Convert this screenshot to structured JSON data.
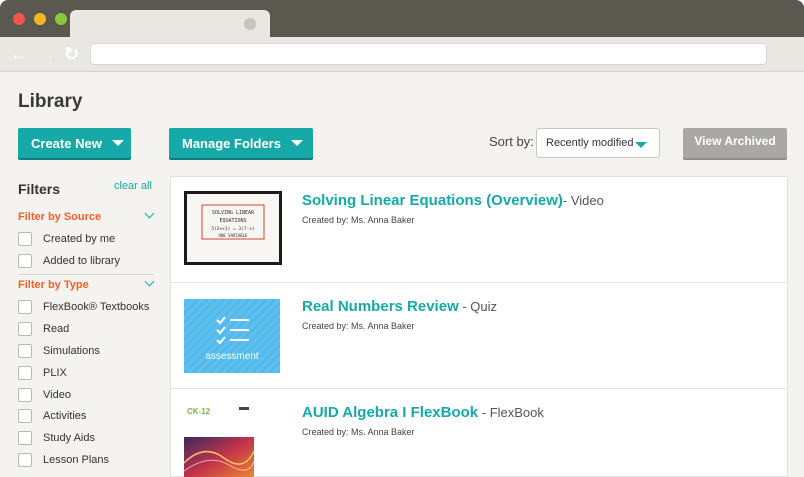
{
  "browser": {
    "back_icon": "←",
    "forward_icon": "→",
    "reload_icon": "↻",
    "address": ""
  },
  "header": {
    "title": "Library",
    "create_new": "Create New",
    "manage_folders": "Manage Folders",
    "sort_by_label": "Sort by:",
    "sort_by_value": "Recently modified",
    "view_archived": "View Archived"
  },
  "filters": {
    "title": "Filters",
    "clear_all": "clear all",
    "source_heading": "Filter by Source",
    "source_items": [
      "Created by me",
      "Added to library"
    ],
    "type_heading": "Filter by Type",
    "type_items": [
      "FlexBook® Textbooks",
      "Read",
      "Simulations",
      "PLIX",
      "Video",
      "Activities",
      "Study Aids",
      "Lesson Plans"
    ]
  },
  "results": [
    {
      "title": "Solving Linear Equations (Overview)",
      "type": "- Video",
      "created_by": "Created by: Ms. Anna Baker",
      "thumb_lines": [
        "SOLVING LINEAR",
        "EQUATIONS",
        "5(2x+3) = 3(7-x)",
        "ONE VARIABLE"
      ]
    },
    {
      "title": "Real Numbers Review",
      "type": " - Quiz",
      "created_by": "Created by: Ms. Anna Baker",
      "thumb_label": "assessment"
    },
    {
      "title": "AUID Algebra I FlexBook",
      "type": " - FlexBook",
      "created_by": "Created by: Ms. Anna Baker",
      "thumb_label": "CK-12"
    }
  ],
  "colors": {
    "accent": "#16a9a7",
    "filter_heading": "#f0612d",
    "archive_button": "#a9a8a4"
  }
}
